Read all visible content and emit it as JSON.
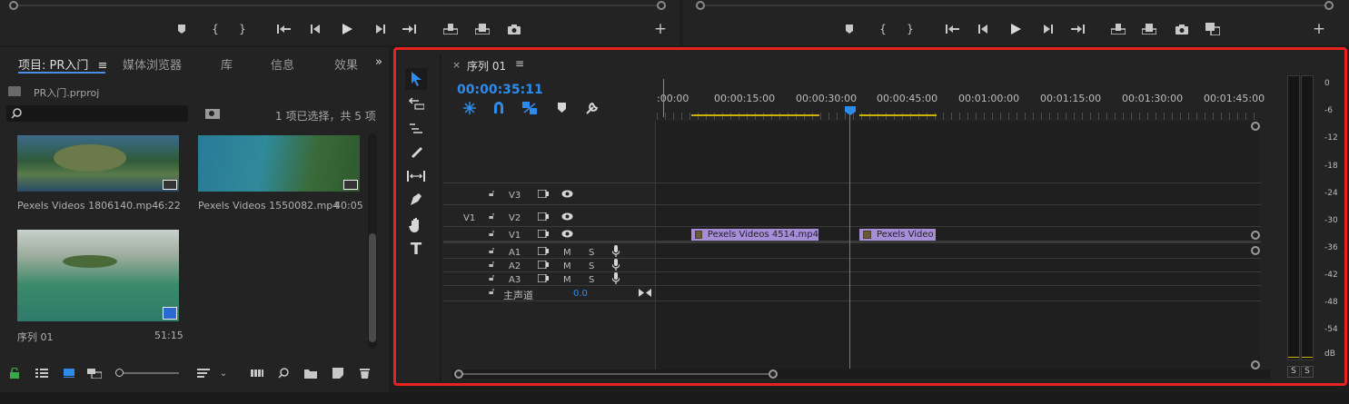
{
  "source_monitor": {
    "buttons": [
      "marker",
      "in",
      "out",
      "go-to-in",
      "step-back",
      "play",
      "step-forward",
      "go-to-out",
      "insert",
      "overwrite",
      "export-frame",
      "add"
    ]
  },
  "program_monitor": {
    "buttons": [
      "marker",
      "in",
      "out",
      "go-to-in",
      "step-back",
      "play",
      "step-forward",
      "go-to-out",
      "lift",
      "extract",
      "export-frame",
      "compare",
      "add"
    ]
  },
  "project_panel": {
    "tabs": [
      "项目: PR入门",
      "媒体浏览器",
      "库",
      "信息",
      "效果"
    ],
    "overflow": "»",
    "project_file": "PR入门.prproj",
    "search_placeholder": "",
    "selection_status": "1 项已选择，共 5 项",
    "items": [
      {
        "name": "Pexels Videos 1806140.mp4",
        "duration": "6:22"
      },
      {
        "name": "Pexels Videos 1550082.mp4",
        "duration": "40:05"
      },
      {
        "name": "序列 01",
        "duration": "51:15"
      }
    ]
  },
  "timeline": {
    "sequence_tab": "序列 01",
    "close": "×",
    "timecode": "00:00:35:11",
    "ruler": [
      ":00:00",
      "00:00:15:00",
      "00:00:30:00",
      "00:00:45:00",
      "00:01:00:00",
      "00:01:15:00",
      "00:01:30:00",
      "00:01:45:00"
    ],
    "tracks": {
      "video": [
        "V3",
        "V2",
        "V1"
      ],
      "audio": [
        "A1",
        "A2",
        "A3"
      ],
      "source_patch": "V1",
      "mute": "M",
      "solo": "S",
      "master": "主声道",
      "master_value": "0.0"
    },
    "clips": [
      {
        "name": "Pexels Videos 4514.mp4"
      },
      {
        "name": "Pexels Video"
      }
    ]
  },
  "audio_meter": {
    "scale": [
      "0",
      "-6",
      "-12",
      "-18",
      "-24",
      "-30",
      "-36",
      "-42",
      "-48",
      "-54",
      "dB"
    ],
    "solo_left": "S",
    "solo_right": "S"
  },
  "colors": {
    "accent_blue": "#2d8ceb",
    "highlight_border": "#e8231f",
    "clip_fill": "#a68dd8",
    "work_area": "#c8b400"
  }
}
